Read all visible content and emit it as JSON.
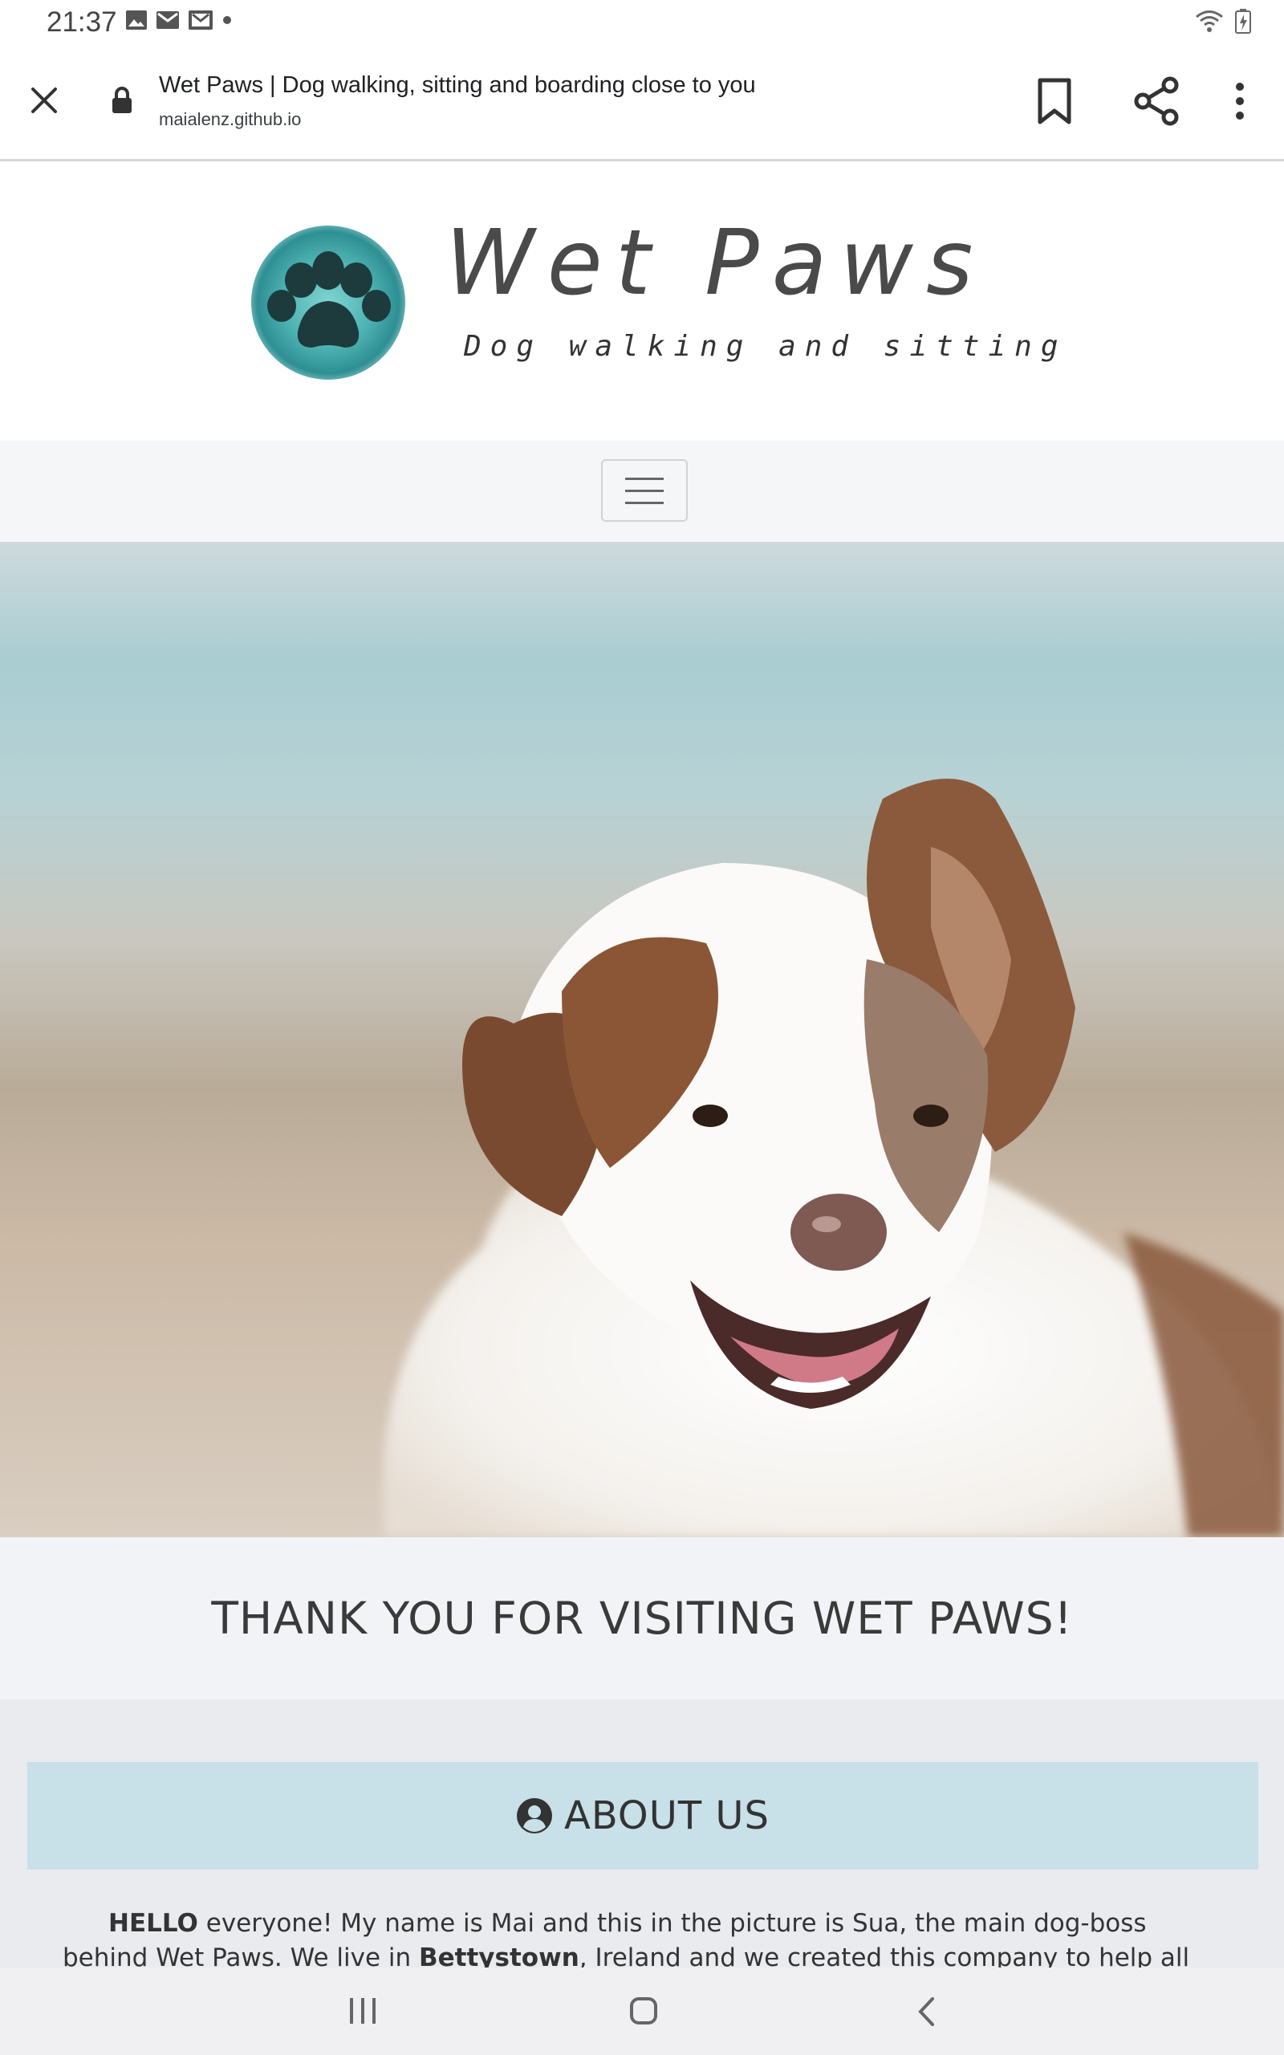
{
  "status_bar": {
    "time": "21:37",
    "notification_icons": [
      "gallery-icon",
      "mail-icon",
      "gmail-icon",
      "dot-icon"
    ],
    "system_icons": [
      "wifi-icon",
      "battery-icon"
    ]
  },
  "browser": {
    "page_title": "Wet Paws | Dog walking, sitting and boarding close to you",
    "url": "maialenz.github.io",
    "actions": [
      "close-icon",
      "bookmark-icon",
      "share-icon",
      "more-icon"
    ]
  },
  "logo": {
    "title": "Wet Paws",
    "tagline": "Dog walking and sitting",
    "icon": "paw-icon",
    "accent_color": "#4fb3b3"
  },
  "nav": {
    "toggle_icon": "hamburger-icon"
  },
  "hero": {
    "icon": "dog-photo"
  },
  "thanks": {
    "text": "THANK YOU FOR VISITING WET PAWS!"
  },
  "about": {
    "title": "ABOUT US",
    "icon": "user-circle-icon",
    "header_color": "#c8e0e7",
    "text_bold_1": "HELLO",
    "text_part_1": " everyone! My name is Mai and this in the picture is Sua, the main dog-boss behind Wet Paws. We live in ",
    "text_bold_2": "Bettystown",
    "text_part_2": ", Ireland and we created this company to help all dog parents to keep"
  },
  "system_nav": {
    "buttons": [
      "recent-apps-icon",
      "home-icon",
      "back-icon"
    ]
  }
}
